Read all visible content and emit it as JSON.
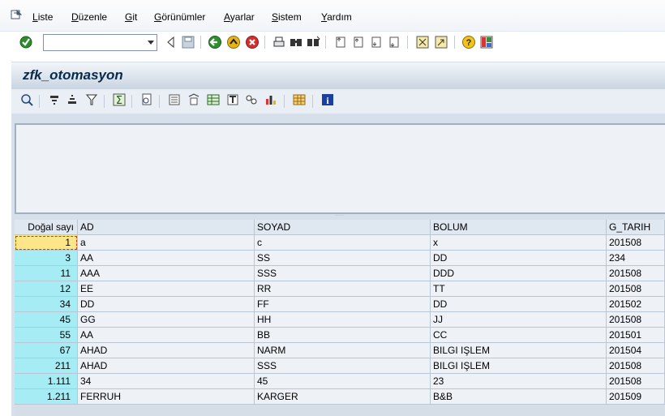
{
  "menu": {
    "items": [
      "Liste",
      "Düzenle",
      "Git",
      "Görünümler",
      "Ayarlar",
      "Sistem",
      "Yardım"
    ]
  },
  "system_toolbar": {
    "command_field_value": "",
    "icons": [
      "enter-icon",
      "back-icon",
      "save-icon",
      "back-green-icon",
      "exit-icon",
      "cancel-icon",
      "print-icon",
      "find-icon",
      "find-next-icon",
      "first-page-icon",
      "previous-page-icon",
      "next-page-icon",
      "last-page-icon",
      "create-session-icon",
      "shortcut-icon",
      "help-icon",
      "layout-menu-icon"
    ]
  },
  "title": "zfk_otomasyon",
  "app_toolbar": {
    "icons": [
      "details-icon",
      "sort-ascending-icon",
      "sort-descending-icon",
      "filter-icon",
      "sum-icon",
      "print-preview-icon",
      "export-icon",
      "word-processing-icon",
      "spreadsheet-icon",
      "local-file-icon",
      "abc-analysis-icon",
      "graphic-icon",
      "change-layout-icon",
      "information-icon"
    ]
  },
  "table": {
    "headers": [
      "Doğal sayı",
      "AD",
      "SOYAD",
      "BOLUM",
      "G_TARIH"
    ],
    "rows": [
      [
        "1",
        "a",
        "c",
        "x",
        "201508"
      ],
      [
        "3",
        "AA",
        "SS",
        "DD",
        "234"
      ],
      [
        "11",
        "AAA",
        "SSS",
        "DDD",
        "201508"
      ],
      [
        "12",
        "EE",
        "RR",
        "TT",
        "201508"
      ],
      [
        "34",
        "DD",
        "FF",
        "DD",
        "201502"
      ],
      [
        "45",
        "GG",
        "HH",
        "JJ",
        "201508"
      ],
      [
        "55",
        "AA",
        "BB",
        "CC",
        "201501"
      ],
      [
        "67",
        "AHAD",
        "NARM",
        "BILGI IŞLEM",
        "201504"
      ],
      [
        "211",
        "AHAD",
        "SSS",
        "BILGI IŞLEM",
        "201508"
      ],
      [
        "1.111",
        "34",
        "45",
        "23",
        "201508"
      ],
      [
        "1.211",
        "FERRUH",
        "KARGER",
        "B&B",
        "201509"
      ]
    ]
  },
  "colors": {
    "key_column": "#a6ecf5",
    "data_cells": "#eef2f7",
    "selected_cell": "#fde58a",
    "title_text": "#0a2a4a"
  }
}
